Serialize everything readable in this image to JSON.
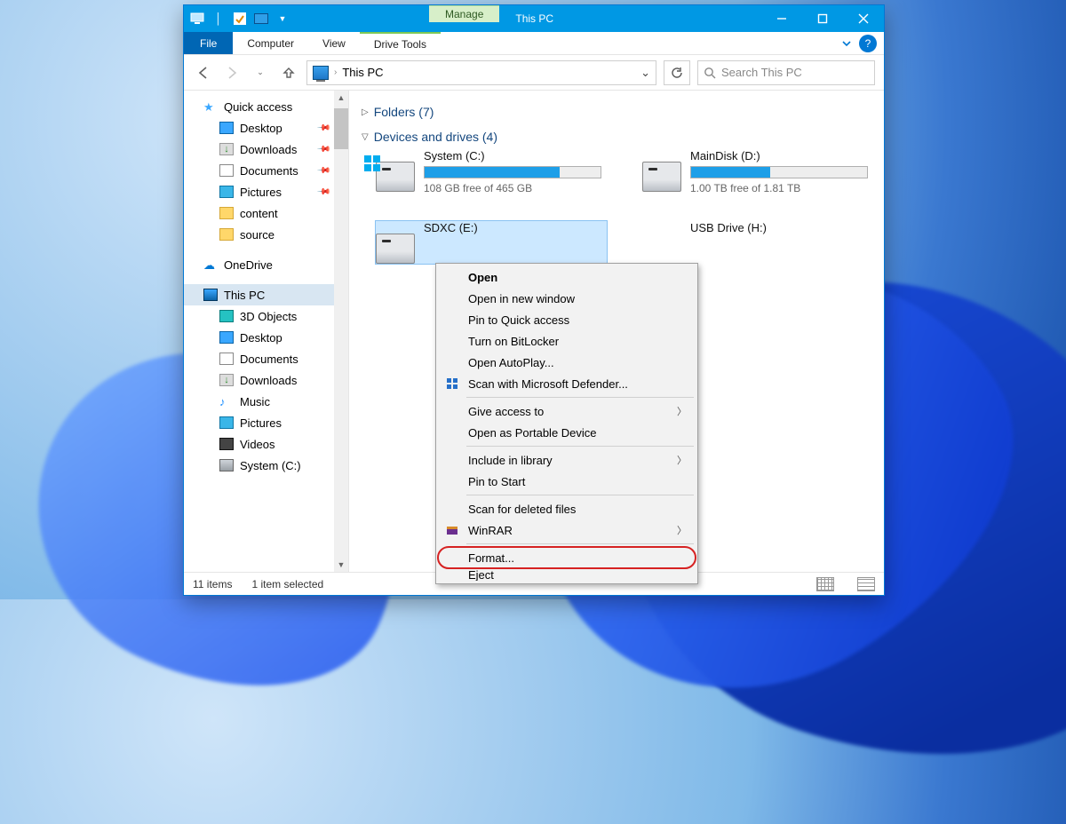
{
  "window": {
    "manage_label": "Manage",
    "title": "This PC"
  },
  "tabs": {
    "file": "File",
    "computer": "Computer",
    "view": "View",
    "drive_tools": "Drive Tools"
  },
  "address": {
    "location": "This PC",
    "search_placeholder": "Search This PC"
  },
  "sidebar": {
    "quick_access": "Quick access",
    "desktop": "Desktop",
    "downloads": "Downloads",
    "documents": "Documents",
    "pictures": "Pictures",
    "content": "content",
    "source": "source",
    "onedrive": "OneDrive",
    "this_pc": "This PC",
    "objects3d": "3D Objects",
    "desktop2": "Desktop",
    "documents2": "Documents",
    "downloads2": "Downloads",
    "music": "Music",
    "pictures2": "Pictures",
    "videos": "Videos",
    "system_c": "System (C:)"
  },
  "groups": {
    "folders": "Folders (7)",
    "devices": "Devices and drives (4)"
  },
  "drives": {
    "c": {
      "name": "System (C:)",
      "free": "108 GB free of 465 GB",
      "fill_pct": 77
    },
    "d": {
      "name": "MainDisk (D:)",
      "free": "1.00 TB free of 1.81 TB",
      "fill_pct": 45
    },
    "e": {
      "name": "SDXC (E:)"
    },
    "h": {
      "name": "USB Drive (H:)"
    }
  },
  "context_menu": {
    "open": "Open",
    "open_new": "Open in new window",
    "pin_qa": "Pin to Quick access",
    "bitlocker": "Turn on BitLocker",
    "autoplay": "Open AutoPlay...",
    "defender": "Scan with Microsoft Defender...",
    "give_access": "Give access to",
    "portable": "Open as Portable Device",
    "include_lib": "Include in library",
    "pin_start": "Pin to Start",
    "scan_deleted": "Scan for deleted files",
    "winrar": "WinRAR",
    "format": "Format...",
    "eject": "Eject"
  },
  "status": {
    "items": "11 items",
    "selected": "1 item selected"
  },
  "colors": {
    "accent": "#0098e4",
    "accent_dark": "#0066b4",
    "highlight": "#cce8ff"
  }
}
